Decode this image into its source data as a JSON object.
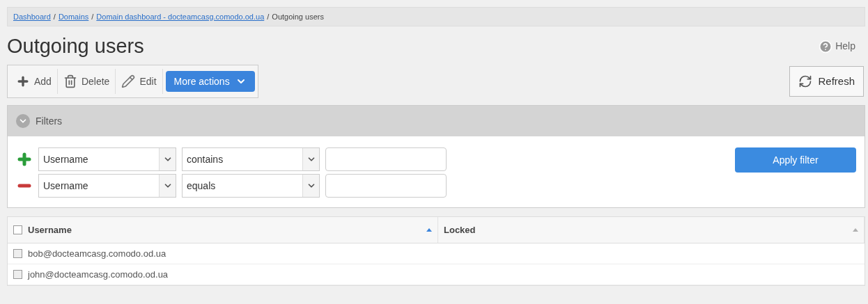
{
  "breadcrumb": {
    "links": [
      "Dashboard",
      "Domains",
      "Domain dashboard - docteamcasg.comodo.od.ua"
    ],
    "current": "Outgoing users",
    "separator": "/"
  },
  "title": "Outgoing users",
  "help": "Help",
  "toolbar": [
    {
      "kind": "add",
      "label": "Add"
    },
    {
      "kind": "delete",
      "label": "Delete"
    },
    {
      "kind": "edit",
      "label": "Edit"
    },
    {
      "kind": "menu",
      "label": "More actions"
    }
  ],
  "refresh": "Refresh",
  "filters": {
    "title": "Filters",
    "apply": "Apply filter",
    "rows": [
      {
        "kind": "add",
        "field": "Username",
        "operator": "contains"
      },
      {
        "kind": "remove",
        "field": "Username",
        "operator": "equals"
      }
    ]
  },
  "table": {
    "all_checked": false,
    "columns": [
      {
        "label": "Username",
        "sorted": true
      },
      {
        "label": "Locked",
        "sorted": false
      }
    ],
    "rows": [
      {
        "username": "bob@docteamcasg.comodo.od.ua",
        "checked": false
      },
      {
        "username": "john@docteamcasg.comodo.od.ua",
        "checked": false
      }
    ]
  }
}
